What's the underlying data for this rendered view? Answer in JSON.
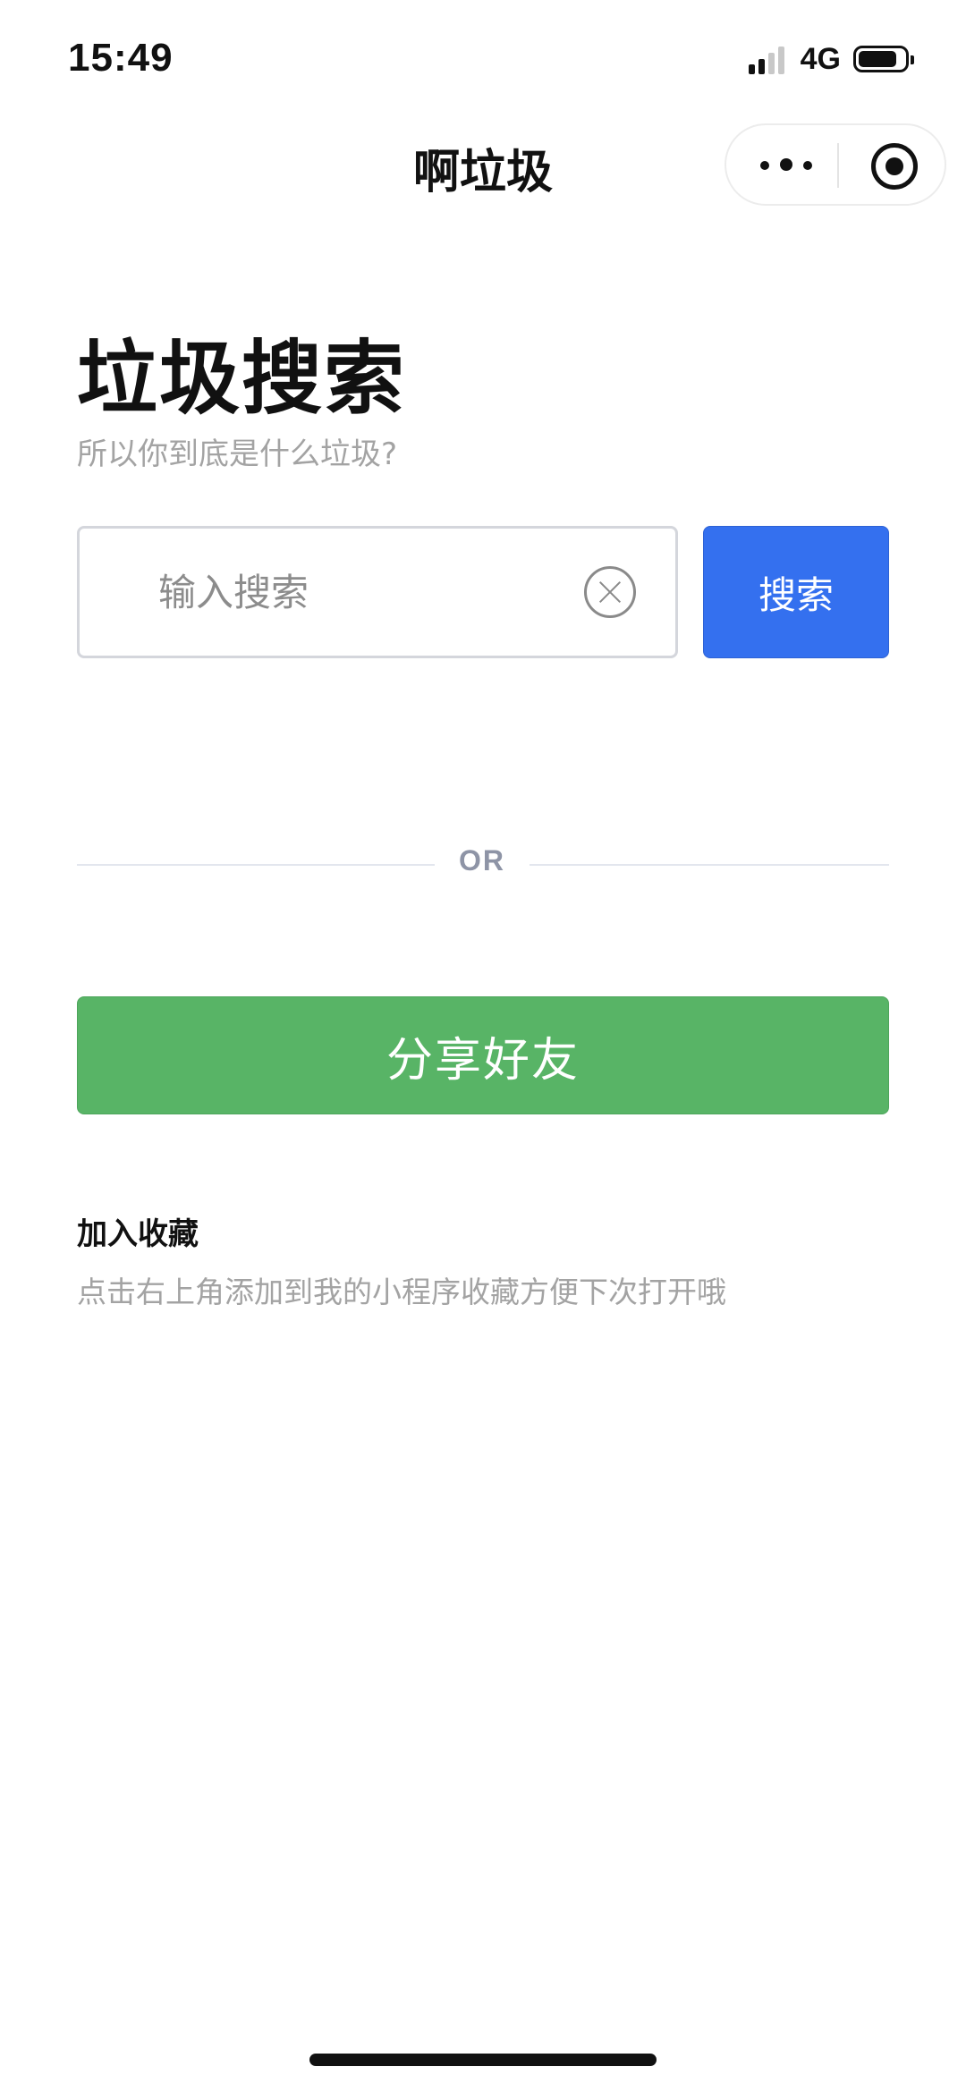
{
  "status_bar": {
    "time": "15:49",
    "network": "4G",
    "battery_level": 0.75,
    "signal_bars_active": 2
  },
  "nav": {
    "title": "啊垃圾"
  },
  "header": {
    "title": "垃圾搜索",
    "subtitle": "所以你到底是什么垃圾?"
  },
  "search": {
    "placeholder": "输入搜索",
    "value": "",
    "button_label": "搜索"
  },
  "divider": {
    "label": "OR"
  },
  "share": {
    "button_label": "分享好友"
  },
  "favorites": {
    "title": "加入收藏",
    "description": "点击右上角添加到我的小程序收藏方便下次打开哦"
  },
  "colors": {
    "primary_blue": "#3470ef",
    "share_green": "#58b466",
    "muted_text": "#a3a3a3"
  },
  "icons": {
    "more": "more-dots-icon",
    "close_mini": "target-circle-icon",
    "clear": "clear-circle-x-icon"
  }
}
